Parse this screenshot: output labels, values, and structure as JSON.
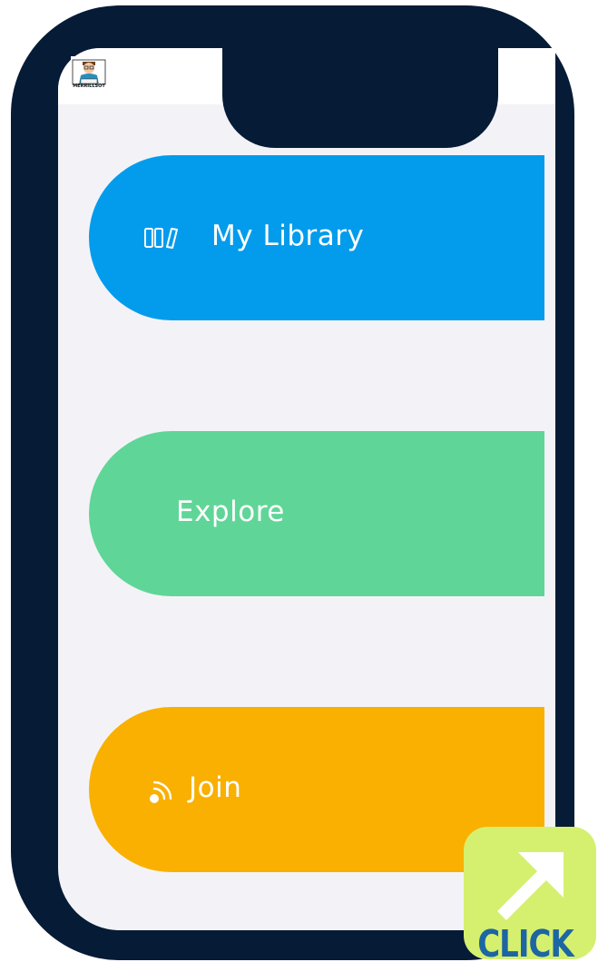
{
  "app": {
    "logo_text": "MERRILLSOT"
  },
  "menu": {
    "items": [
      {
        "label": "My Library",
        "icon": "books-icon",
        "color": "#039cec"
      },
      {
        "label": "Explore",
        "icon": "",
        "color": "#5fd697"
      },
      {
        "label": "Join",
        "icon": "rss-icon",
        "color": "#f9b001"
      }
    ]
  },
  "badge": {
    "label": "CLICK",
    "icon": "arrow-up-right-icon",
    "color": "#d5f06e",
    "text_color": "#1d66a3"
  },
  "colors": {
    "frame": "#061b36",
    "screen_background": "#f3f3f7"
  }
}
